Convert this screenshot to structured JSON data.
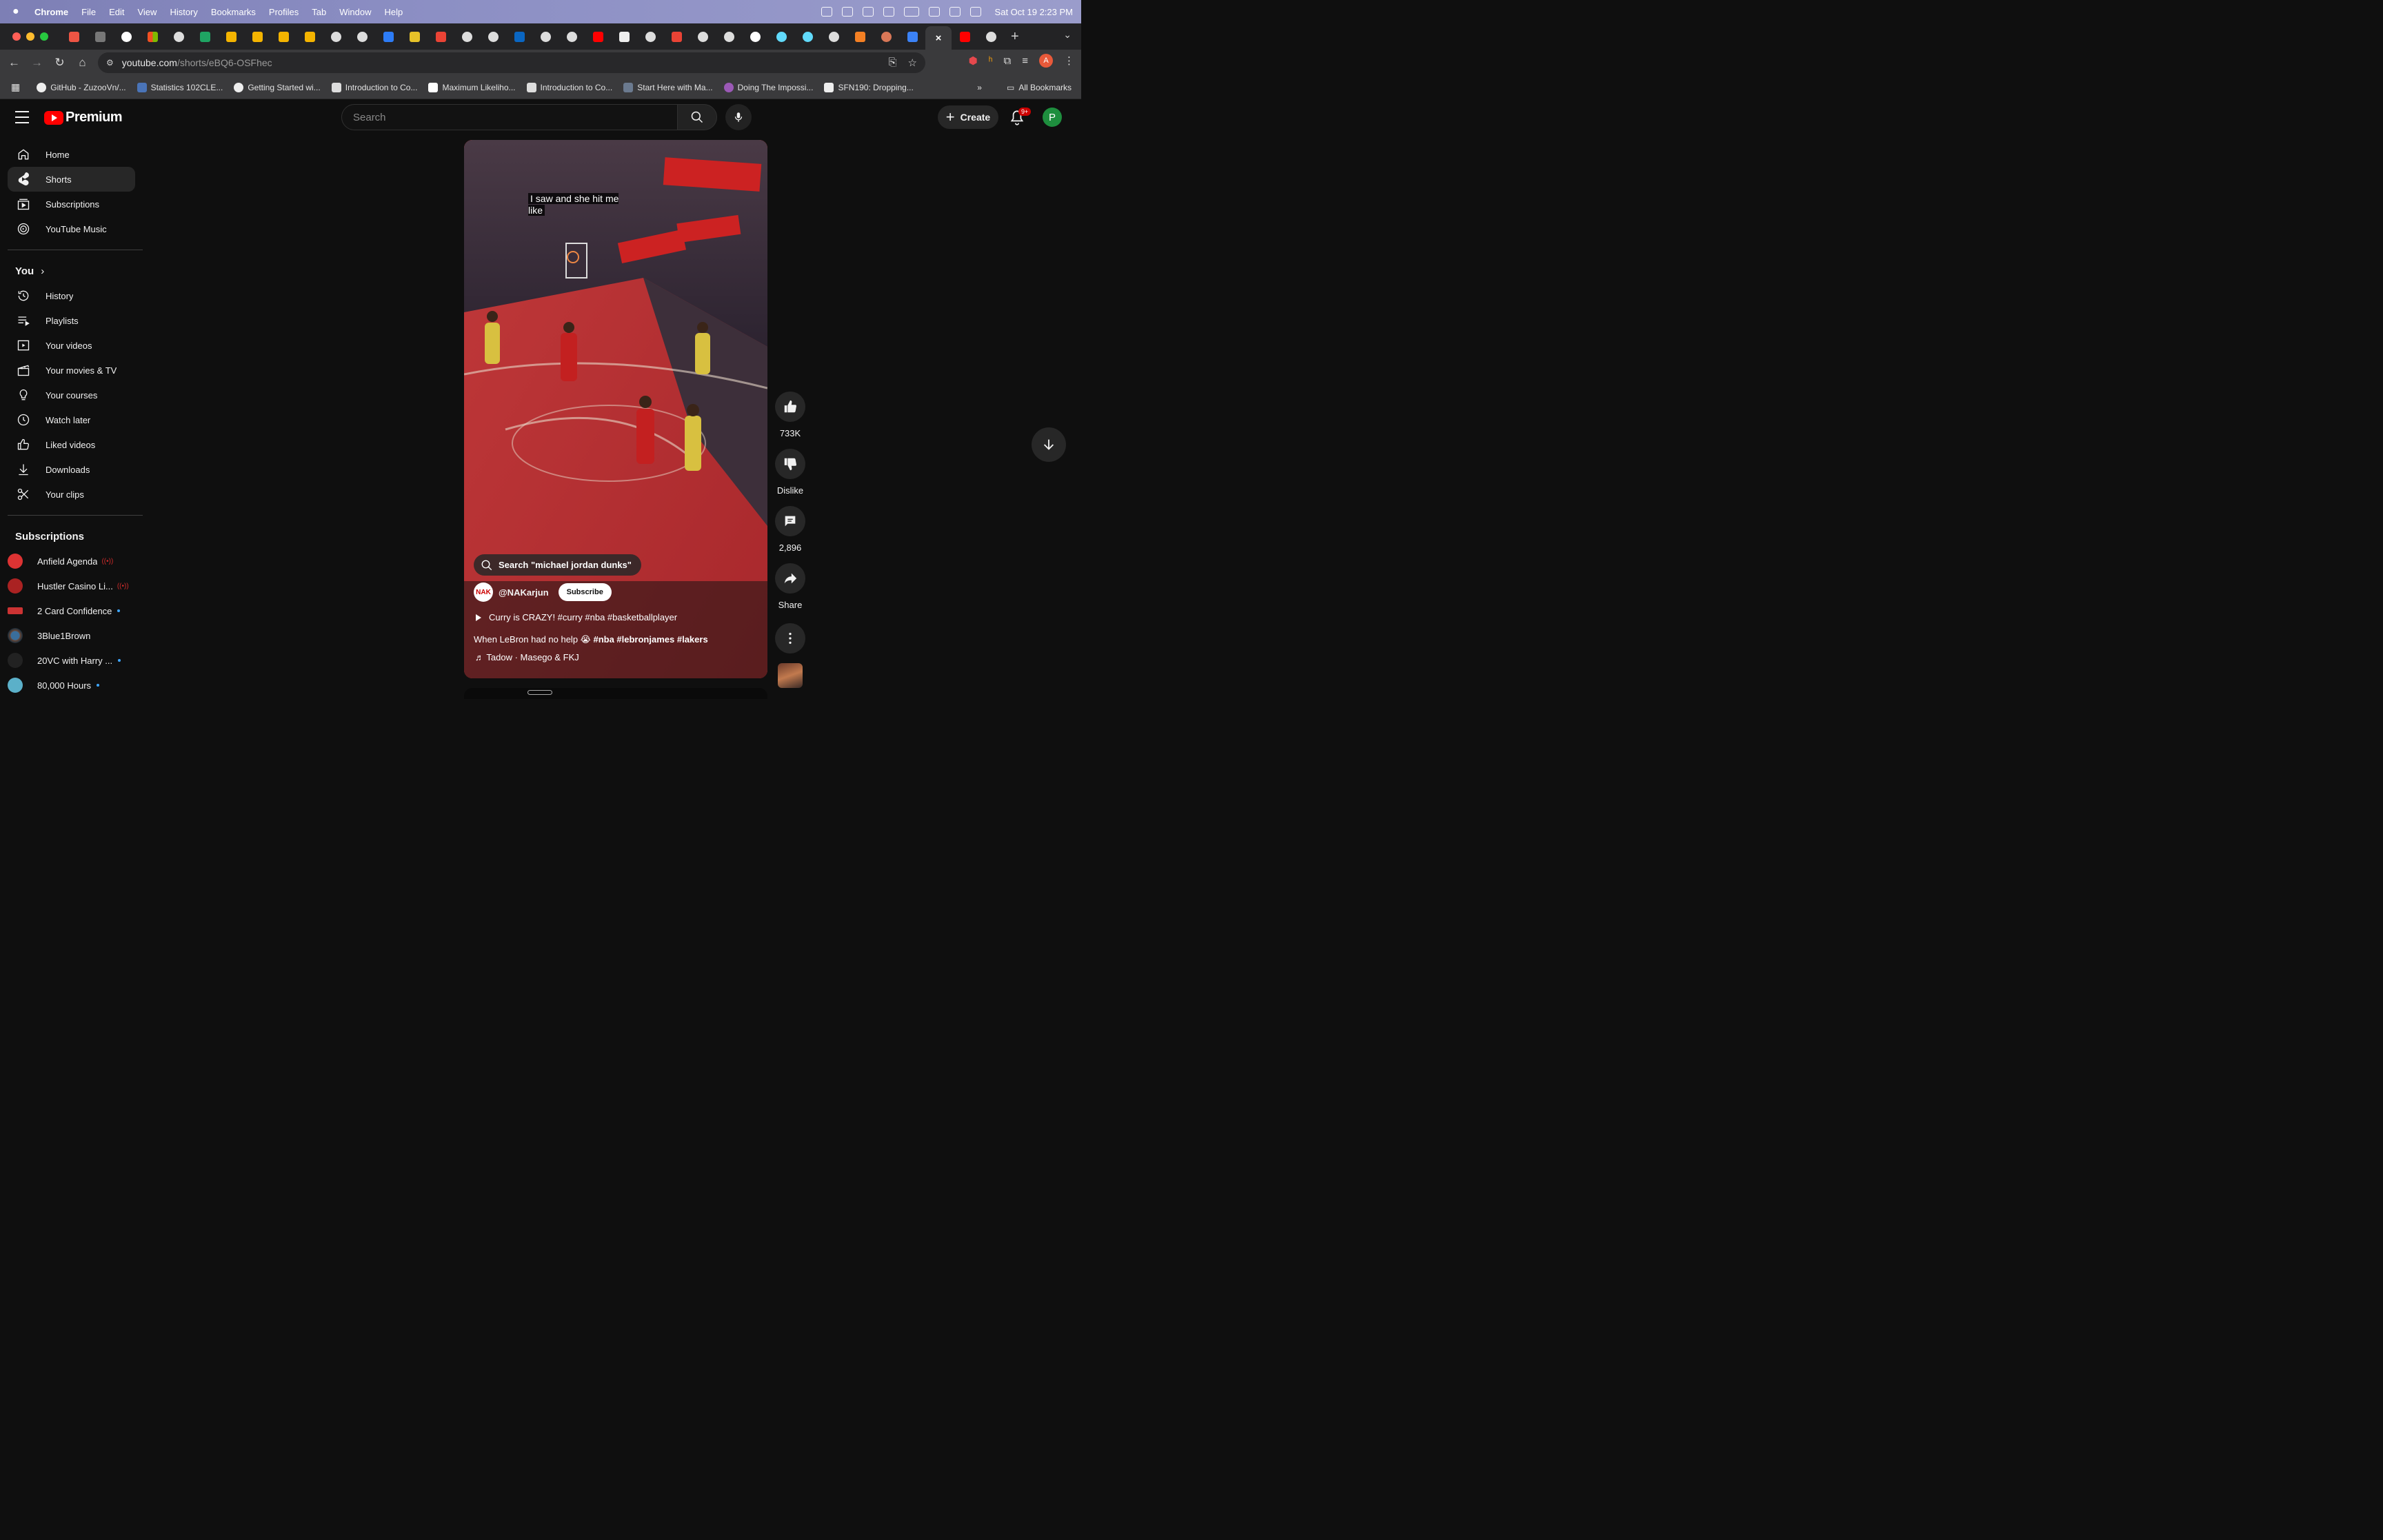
{
  "menubar": {
    "app": "Chrome",
    "items": [
      "File",
      "Edit",
      "View",
      "History",
      "Bookmarks",
      "Profiles",
      "Tab",
      "Window",
      "Help"
    ],
    "clock": "Sat Oct 19  2:23 PM"
  },
  "browser": {
    "url_site": "youtube.com",
    "url_path": "/shorts/eBQ6-OSFhec",
    "bookmarks": [
      "GitHub - ZuzooVn/...",
      "Statistics 102CLE...",
      "Getting Started wi...",
      "Introduction to Co...",
      "Maximum Likeliho...",
      "Introduction to Co...",
      "Start Here with Ma...",
      "Doing The Impossi...",
      "SFN190: Dropping..."
    ],
    "all_bookmarks": "All Bookmarks",
    "profile_initial": "A"
  },
  "header": {
    "logo_text": "Premium",
    "search_placeholder": "Search",
    "create_label": "Create",
    "notif_badge": "9+",
    "avatar_initial": "P"
  },
  "sidebar": {
    "main": [
      {
        "label": "Home",
        "icon": "home-icon"
      },
      {
        "label": "Shorts",
        "icon": "shorts-icon"
      },
      {
        "label": "Subscriptions",
        "icon": "subscriptions-icon"
      },
      {
        "label": "YouTube Music",
        "icon": "music-icon"
      }
    ],
    "you_heading": "You",
    "you": [
      {
        "label": "History",
        "icon": "history-icon"
      },
      {
        "label": "Playlists",
        "icon": "playlists-icon"
      },
      {
        "label": "Your videos",
        "icon": "your-videos-icon"
      },
      {
        "label": "Your movies & TV",
        "icon": "movies-icon"
      },
      {
        "label": "Your courses",
        "icon": "courses-icon"
      },
      {
        "label": "Watch later",
        "icon": "clock-icon"
      },
      {
        "label": "Liked videos",
        "icon": "thumbs-up-icon"
      },
      {
        "label": "Downloads",
        "icon": "download-icon"
      },
      {
        "label": "Your clips",
        "icon": "scissors-icon"
      }
    ],
    "subs_heading": "Subscriptions",
    "subscriptions": [
      {
        "label": "Anfield Agenda",
        "status": "live",
        "color": "#d33"
      },
      {
        "label": "Hustler Casino Li...",
        "status": "live",
        "color": "#a22"
      },
      {
        "label": "2 Card Confidence",
        "status": "new",
        "color": "#c33"
      },
      {
        "label": "3Blue1Brown",
        "status": "",
        "color": "#1a4c7a"
      },
      {
        "label": "20VC with Harry ...",
        "status": "new",
        "color": "#222"
      },
      {
        "label": "80,000 Hours",
        "status": "new",
        "color": "#5bb0c9"
      }
    ]
  },
  "short": {
    "caption": "I saw and she hit me like",
    "search_chip": "Search \"michael jordan dunks\"",
    "channel": "@NAKarjun",
    "subscribe": "Subscribe",
    "related": "Curry is CRAZY! #curry #nba #basketballplayer",
    "title_text": "When LeBron had no help 😭 ",
    "title_tags": "#nba #lebronjames  #lakers",
    "music": "Tadow · Masego & FKJ",
    "likes": "733K",
    "dislike": "Dislike",
    "comments": "2,896",
    "share": "Share"
  }
}
